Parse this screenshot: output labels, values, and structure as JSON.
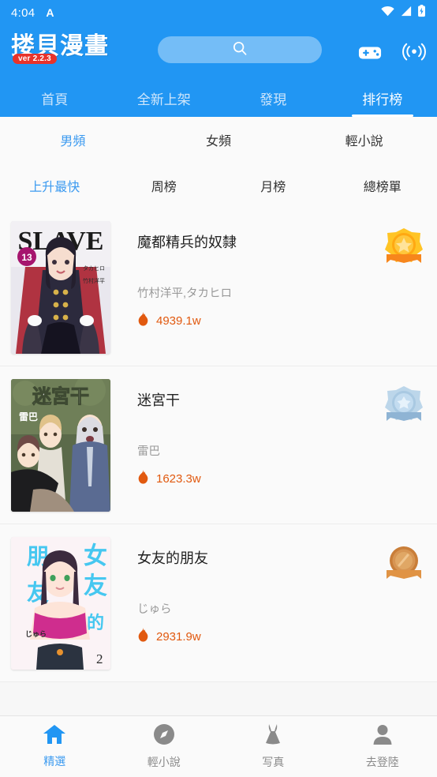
{
  "statusbar": {
    "time": "4:04",
    "indicator_letter": "A",
    "icons": [
      "wifi-icon",
      "signal-icon",
      "battery-charging-icon"
    ]
  },
  "header": {
    "logo_text": "搂貝漫畫",
    "version_badge": "ver 2.2.3",
    "search_placeholder": "",
    "search_icon": "search-icon",
    "gamepad_icon": "gamepad-icon",
    "broadcast_icon": "broadcast-icon",
    "background_color": "#2196F3"
  },
  "top_tabs": [
    {
      "label": "首頁",
      "active": false
    },
    {
      "label": "全新上架",
      "active": false
    },
    {
      "label": "發現",
      "active": false
    },
    {
      "label": "排行榜",
      "active": true
    }
  ],
  "category_filters": [
    {
      "label": "男頻",
      "active": true
    },
    {
      "label": "女頻",
      "active": false
    },
    {
      "label": "輕小說",
      "active": false
    }
  ],
  "ranking_filters": [
    {
      "label": "上升最快",
      "active": true
    },
    {
      "label": "周榜",
      "active": false
    },
    {
      "label": "月榜",
      "active": false
    },
    {
      "label": "總榜單",
      "active": false
    }
  ],
  "accent_color": "#3d9bf0",
  "views_color": "#e1590f",
  "list": [
    {
      "rank": 1,
      "title": "魔都精兵的奴隸",
      "author": "竹村洋平,タカヒロ",
      "views": "4939.1w",
      "medal": "gold-medal-icon",
      "cover": {
        "headline": "SLAVE",
        "volume": "13",
        "credits": [
          "タカヒロ",
          "竹村洋平"
        ]
      }
    },
    {
      "rank": 2,
      "title": "迷宮干",
      "author": "雷巴",
      "views": "1623.3w",
      "medal": "silver-medal-icon",
      "cover": {
        "headline": "迷宮干",
        "volume": "",
        "credits": [
          "雷巴"
        ]
      }
    },
    {
      "rank": 3,
      "title": "女友的朋友",
      "author": "じゅら",
      "views": "2931.9w",
      "medal": "bronze-medal-icon",
      "cover": {
        "headline": "女友的朋友",
        "volume": "2",
        "credits": [
          "じゅら"
        ]
      }
    }
  ],
  "bottom_nav": [
    {
      "label": "精選",
      "icon": "home-icon",
      "active": true
    },
    {
      "label": "輕小說",
      "icon": "compass-icon",
      "active": false
    },
    {
      "label": "写真",
      "icon": "dress-icon",
      "active": false
    },
    {
      "label": "去登陸",
      "icon": "person-icon",
      "active": false
    }
  ]
}
